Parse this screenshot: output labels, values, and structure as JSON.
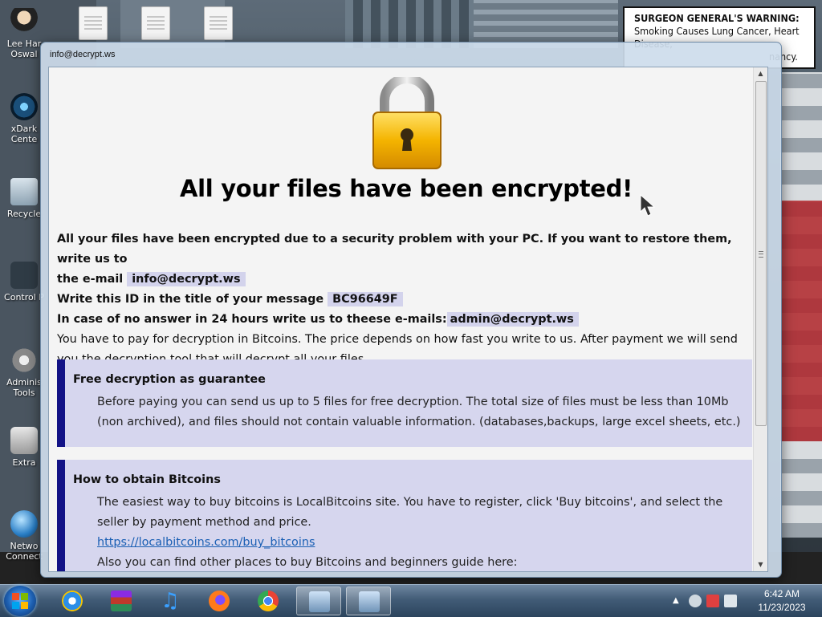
{
  "window": {
    "title": "info@decrypt.ws"
  },
  "note": {
    "headline": "All your files have been encrypted!",
    "line1": "All your files have been encrypted due to a security problem with your PC. If you want to restore them, write us to",
    "line2_prefix": "the e-mail",
    "email1": "info@decrypt.ws",
    "line3_prefix": "Write this ID in the title of your message",
    "id": "BC96649F",
    "line4_prefix": "In case of no answer in 24 hours write us to theese e-mails:",
    "email2": "admin@decrypt.ws",
    "payment_text": "You have to pay for decryption in Bitcoins. The price depends on how fast you write to us. After payment we will send you the decryption tool that will decrypt all your files."
  },
  "guarantee": {
    "title": "Free decryption as guarantee",
    "text": "Before paying you can send us up to 5 files for free decryption. The total size of files must be less than 10Mb (non archived), and files should not contain valuable information. (databases,backups, large excel sheets, etc.)"
  },
  "bitcoins": {
    "title": "How to obtain Bitcoins",
    "text": "The easiest way to buy bitcoins is LocalBitcoins site. You have to register, click 'Buy bitcoins', and select the seller by payment method and price.",
    "link": "https://localbitcoins.com/buy_bitcoins",
    "text2": "Also you can find other places to buy Bitcoins and beginners guide here:"
  },
  "desktop": {
    "warning_bold": "SURGEON GENERAL'S WARNING:",
    "warning_rest": "Smoking Causes Lung Cancer, Heart Disease,",
    "warning_tail": "nancy.",
    "icons": [
      {
        "label": "Lee Har Oswal",
        "icon": "person-icon"
      },
      {
        "label": "xDark Cente",
        "icon": "disc-icon"
      },
      {
        "label": "Recycle",
        "icon": "recycle-bin-icon"
      },
      {
        "label": "Control P",
        "icon": "control-panel-icon"
      },
      {
        "label": "Adminis Tools",
        "icon": "gears-icon"
      },
      {
        "label": "Extra",
        "icon": "folder-icon"
      },
      {
        "label": "Netwo Connect",
        "icon": "network-icon"
      }
    ]
  },
  "taskbar": {
    "items": [
      {
        "name": "internet-explorer",
        "icon": "internet-explorer-icon"
      },
      {
        "name": "winrar",
        "icon": "archive-icon"
      },
      {
        "name": "music",
        "icon": "music-note-icon"
      },
      {
        "name": "firefox",
        "icon": "firefox-icon"
      },
      {
        "name": "chrome",
        "icon": "chrome-icon"
      },
      {
        "name": "program-1",
        "icon": "computer-program-icon"
      },
      {
        "name": "program-2",
        "icon": "computer-program-icon"
      }
    ],
    "time": "6:42 AM",
    "date": "11/23/2023"
  },
  "colors": {
    "accent_bar": "#121286",
    "box_bg": "#d6d6ee",
    "highlight": "#d3d3ec",
    "link": "#1a5fb4"
  }
}
